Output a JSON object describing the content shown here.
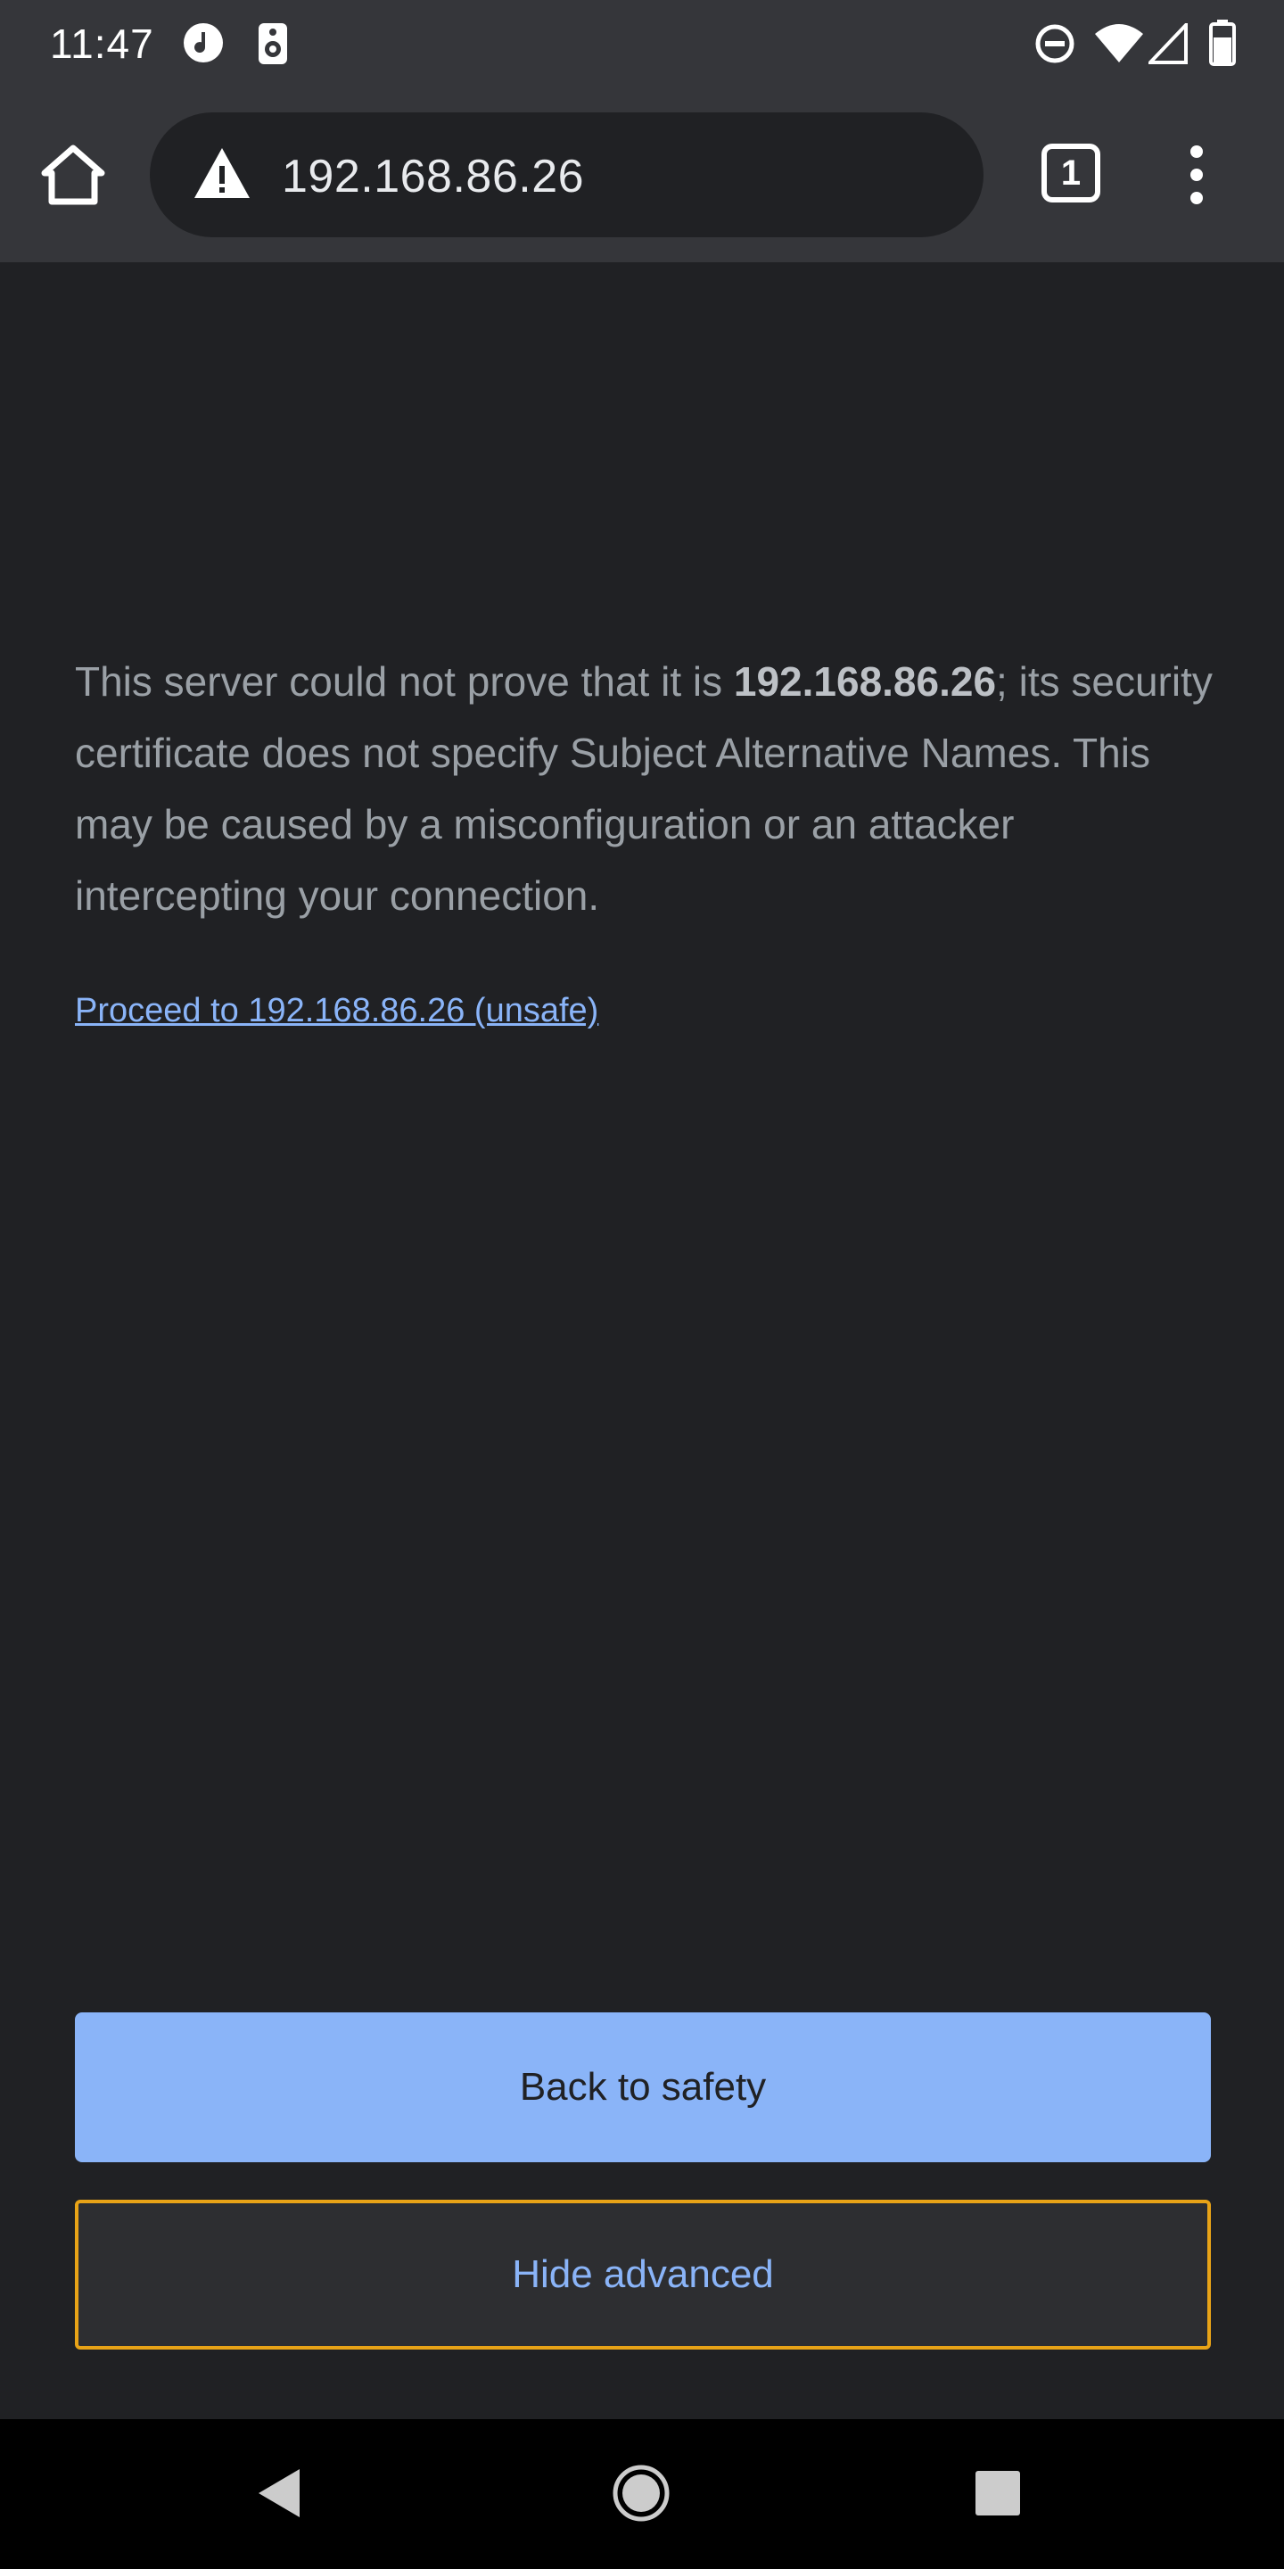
{
  "status_bar": {
    "time": "11:47",
    "icons": [
      "music-note-icon",
      "speaker-icon",
      "do-not-disturb-icon",
      "wifi-icon",
      "cell-signal-icon",
      "battery-icon"
    ]
  },
  "toolbar": {
    "url": "192.168.86.26",
    "tab_count": "1",
    "icons": [
      "home-icon",
      "warning-icon",
      "more-vert-icon"
    ]
  },
  "interstitial": {
    "explanation_pre": "This server could not prove that it is ",
    "explanation_host": "192.168.86.26",
    "explanation_post": "; its security certificate does not specify Subject Alternative Names. This may be caused by a misconfiguration or an attacker intercepting your connection.",
    "proceed_link": "Proceed to 192.168.86.26 (unsafe)",
    "back_button": "Back to safety",
    "hide_advanced_button": "Hide advanced"
  },
  "colors": {
    "background": "#202124",
    "toolbar": "#35363a",
    "primary_button": "#8ab4f8",
    "link": "#8ab4f8",
    "focus_outline": "#e8a317"
  },
  "nav_bar": {
    "icons": [
      "back-triangle-icon",
      "home-circle-icon",
      "recents-square-icon"
    ]
  }
}
